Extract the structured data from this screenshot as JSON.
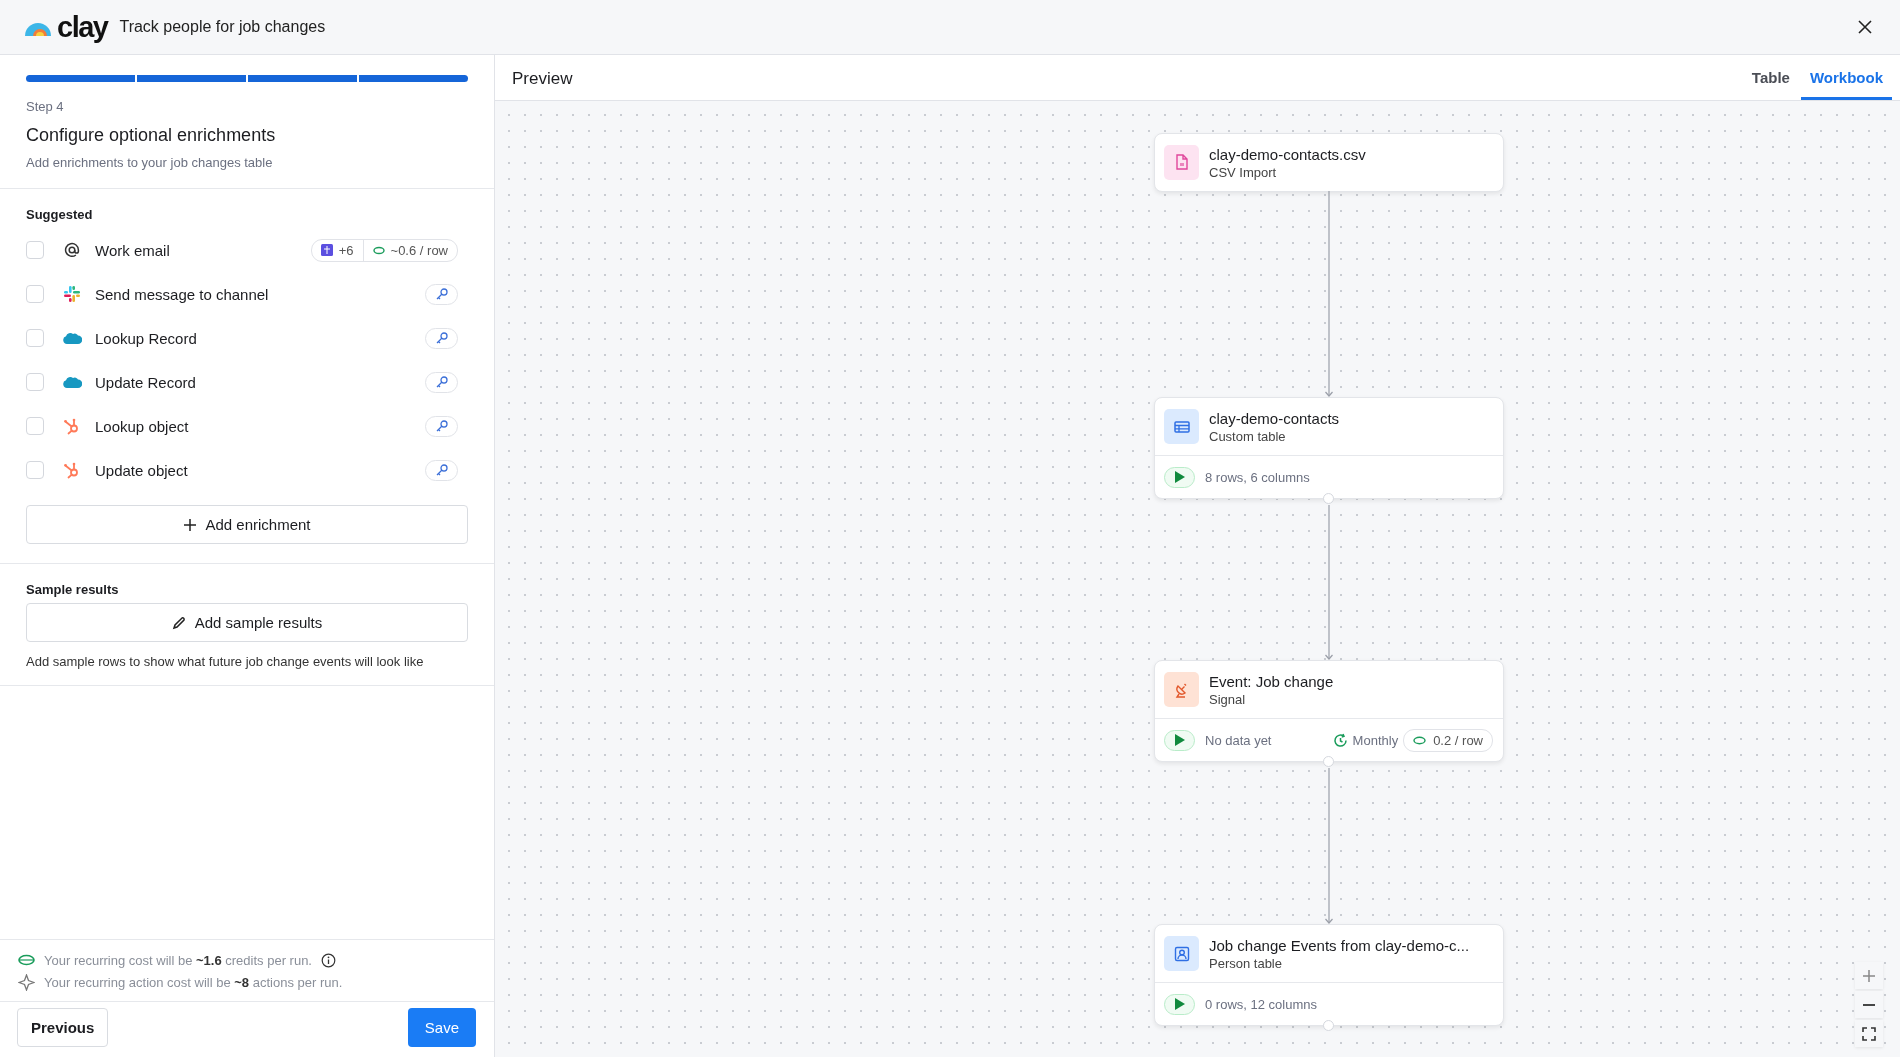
{
  "header": {
    "logo": "clay",
    "title": "Track people for job changes"
  },
  "setup": {
    "progress": [
      {
        "done": true
      },
      {
        "done": true
      },
      {
        "done": true
      },
      {
        "done": true
      }
    ],
    "step": "Step 4",
    "title": "Configure optional enrichments",
    "subtitle": "Add enrichments to your job changes table",
    "suggested_label": "Suggested",
    "items": [
      {
        "kind": "email",
        "label": "Work email",
        "checked": false,
        "providers": "+6",
        "cost": "~0.6 / row"
      },
      {
        "kind": "slack",
        "label": "Send message to channel",
        "checked": false
      },
      {
        "kind": "salesforce",
        "label": "Lookup Record",
        "checked": false
      },
      {
        "kind": "salesforce",
        "label": "Update Record",
        "checked": false
      },
      {
        "kind": "hubspot",
        "label": "Lookup object",
        "checked": false
      },
      {
        "kind": "hubspot",
        "label": "Update object",
        "checked": false
      }
    ],
    "add_button": "Add enrichment",
    "sample_label": "Sample results",
    "sample_button": "Add sample results",
    "sample_hint": "Add sample rows to show what future job change events will look like",
    "cost_lines": [
      {
        "kind": "credits",
        "text": "Your recurring cost will be **~1.6** credits per run."
      },
      {
        "kind": "actions",
        "text": "Your recurring action cost will be **~8** actions per run."
      }
    ],
    "previous_button": "Previous",
    "save_button": "Save"
  },
  "preview": {
    "title": "Preview",
    "tabs": [
      {
        "label": "Table",
        "selected": false
      },
      {
        "label": "Workbook",
        "selected": true
      }
    ],
    "nodes": [
      {
        "kind": "csv",
        "title": "clay-demo-contacts.csv",
        "subtitle": "CSV Import"
      },
      {
        "kind": "table",
        "title": "clay-demo-contacts",
        "subtitle": "Custom table",
        "status": "8 rows, 6 columns"
      },
      {
        "kind": "signal",
        "title": "Event: Job change",
        "subtitle": "Signal",
        "status": "No data yet",
        "schedule": "Monthly",
        "cost": "0.2 / row"
      },
      {
        "kind": "person",
        "title": "Job change Events from clay-demo-c...",
        "subtitle": "Person table",
        "status": "0 rows, 12 columns"
      }
    ]
  }
}
